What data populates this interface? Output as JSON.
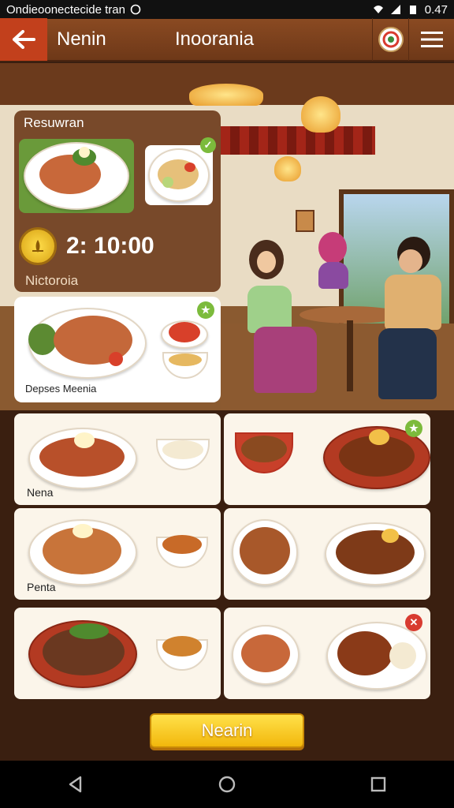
{
  "status_bar": {
    "left_text": "Ondieoonectecide tran",
    "time": "0.47"
  },
  "header": {
    "left_title": "Nenin",
    "center_title": "Inoorania"
  },
  "panel": {
    "section_label": "Resuwran",
    "timer": "2: 10:00",
    "sub_label": "Nictoroia"
  },
  "featured": {
    "caption": "Depses Meenia"
  },
  "grid": {
    "cards": [
      {
        "caption": "Nena"
      },
      {
        "caption": ""
      },
      {
        "caption": "Penta"
      },
      {
        "caption": ""
      },
      {
        "caption": ""
      },
      {
        "caption": ""
      }
    ]
  },
  "cta": {
    "label": "Nearin"
  },
  "colors": {
    "accent": "#c2401c",
    "button": "#f2b70c",
    "panel": "#6e3818"
  }
}
